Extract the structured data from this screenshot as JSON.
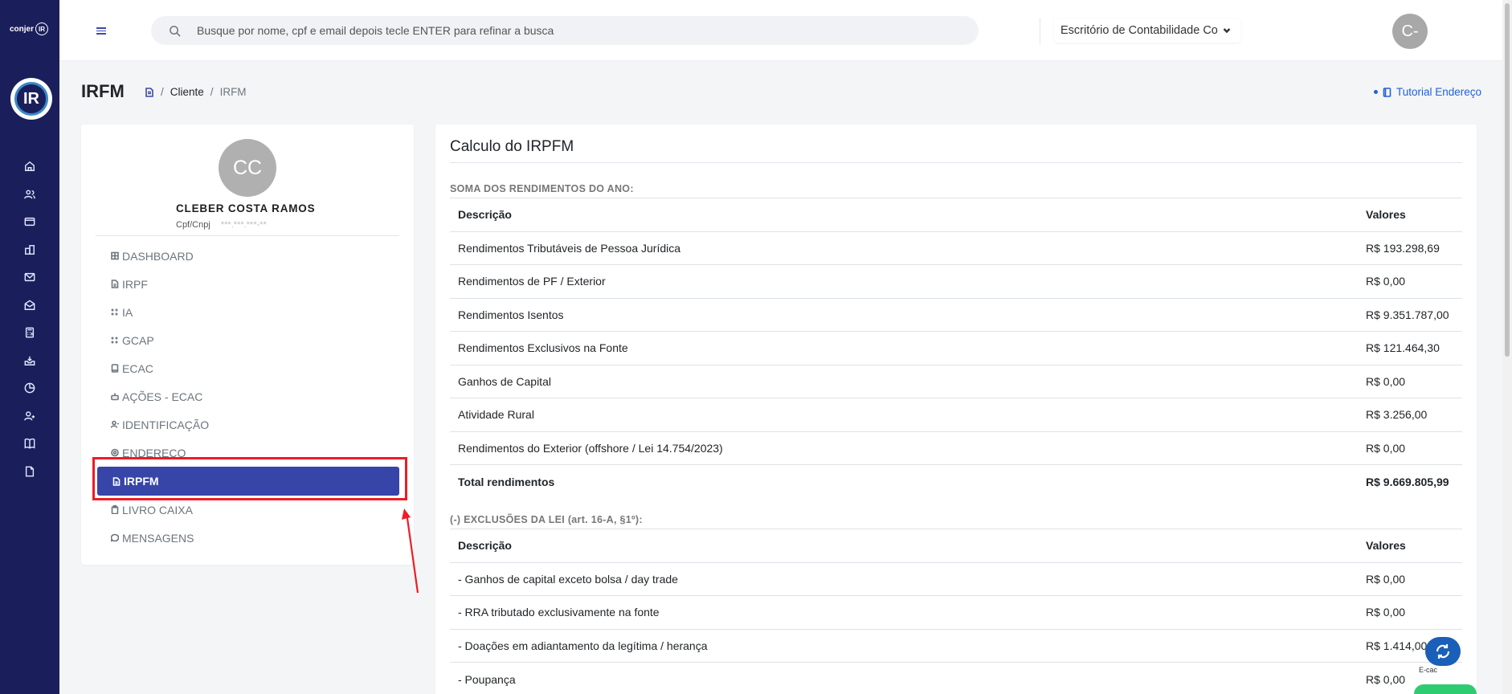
{
  "brand": {
    "text": "conjer",
    "mark": "IR"
  },
  "logo": {
    "text": "IR"
  },
  "rail_icons": [
    "home-icon",
    "users-icon",
    "card-icon",
    "buildings-icon",
    "mail-icon",
    "mail-open-icon",
    "calculator-icon",
    "inbox-icon",
    "chart-pie-icon",
    "user-plus-icon",
    "book-icon",
    "file-icon"
  ],
  "search": {
    "placeholder": "Busque por nome, cpf e email depois tecle ENTER para refinar a busca"
  },
  "office": {
    "selected": "Escritório de Contabilidade Co"
  },
  "user_avatar": {
    "initials": "C-"
  },
  "page": {
    "title": "IRFM",
    "breadcrumb": [
      "Cliente",
      "IRFM"
    ],
    "tutorial_link": "Tutorial Endereço"
  },
  "profile": {
    "initials": "CC",
    "name": "CLEBER COSTA RAMOS",
    "doc_label": "Cpf/Cnpj",
    "doc_value": "***.***.***-**"
  },
  "menu": [
    {
      "label": "DASHBOARD",
      "icon": "grid-icon"
    },
    {
      "label": "IRPF",
      "icon": "file-icon"
    },
    {
      "label": "IA",
      "icon": "sparkles-icon"
    },
    {
      "label": "GCAP",
      "icon": "sparkles-icon"
    },
    {
      "label": "ECAC",
      "icon": "book-icon"
    },
    {
      "label": "AÇÕES - ECAC",
      "icon": "robot-icon"
    },
    {
      "label": "IDENTIFICAÇÃO",
      "icon": "user-icon"
    },
    {
      "label": "ENDEREÇO",
      "icon": "map-pin-icon"
    },
    {
      "label": "IRPFM",
      "icon": "file-icon",
      "active": true
    },
    {
      "label": "LIVRO CAIXA",
      "icon": "clipboard-icon"
    },
    {
      "label": "MENSAGENS",
      "icon": "chat-icon"
    }
  ],
  "main": {
    "title": "Calculo do IRPFM",
    "section1": {
      "label": "SOMA DOS RENDIMENTOS DO ANO:",
      "header": {
        "desc": "Descrição",
        "value": "Valores"
      },
      "rows": [
        {
          "desc": "Rendimentos Tributáveis de Pessoa Jurídica",
          "value": "R$ 193.298,69"
        },
        {
          "desc": "Rendimentos de PF / Exterior",
          "value": "R$ 0,00"
        },
        {
          "desc": "Rendimentos Isentos",
          "value": "R$ 9.351.787,00"
        },
        {
          "desc": "Rendimentos Exclusivos na Fonte",
          "value": "R$ 121.464,30"
        },
        {
          "desc": "Ganhos de Capital",
          "value": "R$ 0,00"
        },
        {
          "desc": "Atividade Rural",
          "value": "R$ 3.256,00"
        },
        {
          "desc": "Rendimentos do Exterior (offshore / Lei 14.754/2023)",
          "value": "R$ 0,00"
        }
      ],
      "total": {
        "desc": "Total rendimentos",
        "value": "R$ 9.669.805,99"
      }
    },
    "section2": {
      "label": "(-) EXCLUSÕES DA LEI (art. 16-A, §1º):",
      "header": {
        "desc": "Descrição",
        "value": "Valores"
      },
      "rows": [
        {
          "desc": "- Ganhos de capital exceto bolsa / day trade",
          "value": "R$ 0,00"
        },
        {
          "desc": "- RRA tributado exclusivamente na fonte",
          "value": "R$ 0,00"
        },
        {
          "desc": "- Doações em adiantamento da legítima / herança",
          "value": "R$ 1.414,00"
        },
        {
          "desc": "- Poupança",
          "value": "R$ 0,00"
        }
      ]
    }
  },
  "ecac_widget": {
    "label": "E-cac"
  },
  "colors": {
    "rail": "#1a1f5c",
    "accent": "#3745a8",
    "highlight": "#ee1c25",
    "link": "#2260d8"
  }
}
